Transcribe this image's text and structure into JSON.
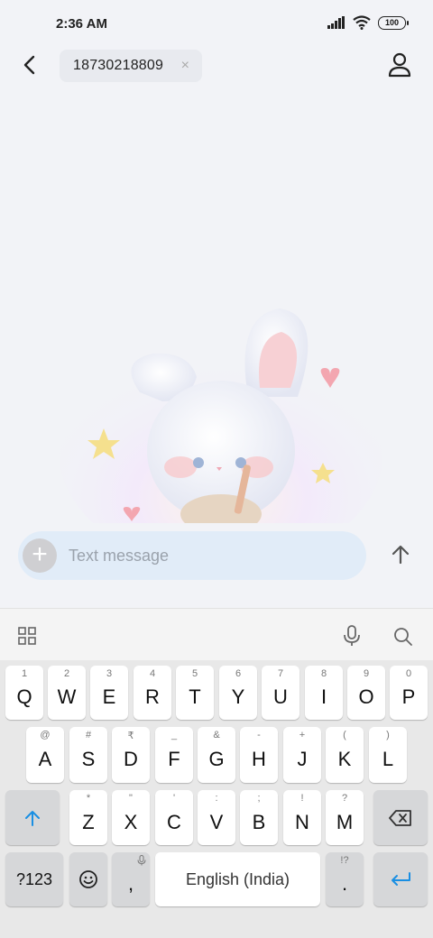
{
  "status_bar": {
    "time": "2:36 AM",
    "battery": "100"
  },
  "header": {
    "recipient": "18730218809",
    "chip_close": "×"
  },
  "composer": {
    "add_symbol": "+",
    "placeholder": "Text message"
  },
  "keyboard": {
    "row1": [
      {
        "hint": "1",
        "label": "Q"
      },
      {
        "hint": "2",
        "label": "W"
      },
      {
        "hint": "3",
        "label": "E"
      },
      {
        "hint": "4",
        "label": "R"
      },
      {
        "hint": "5",
        "label": "T"
      },
      {
        "hint": "6",
        "label": "Y"
      },
      {
        "hint": "7",
        "label": "U"
      },
      {
        "hint": "8",
        "label": "I"
      },
      {
        "hint": "9",
        "label": "O"
      },
      {
        "hint": "0",
        "label": "P"
      }
    ],
    "row2": [
      {
        "hint": "@",
        "label": "A"
      },
      {
        "hint": "#",
        "label": "S"
      },
      {
        "hint": "₹",
        "label": "D"
      },
      {
        "hint": "_",
        "label": "F"
      },
      {
        "hint": "&",
        "label": "G"
      },
      {
        "hint": "-",
        "label": "H"
      },
      {
        "hint": "+",
        "label": "J"
      },
      {
        "hint": "(",
        "label": "K"
      },
      {
        "hint": ")",
        "label": "L"
      }
    ],
    "row3": [
      {
        "hint": "*",
        "label": "Z"
      },
      {
        "hint": "\"",
        "label": "X"
      },
      {
        "hint": "'",
        "label": "C"
      },
      {
        "hint": ":",
        "label": "V"
      },
      {
        "hint": ";",
        "label": "B"
      },
      {
        "hint": "!",
        "label": "N"
      },
      {
        "hint": "?",
        "label": "M"
      }
    ],
    "symbols_label": "?123",
    "comma_label": ",",
    "space_label": "English (India)",
    "period_hint": "!?",
    "period_label": "."
  },
  "colors": {
    "accent": "#1a8fe3",
    "compose_bg": "#e1ecf8",
    "background": "#f2f3f7"
  }
}
